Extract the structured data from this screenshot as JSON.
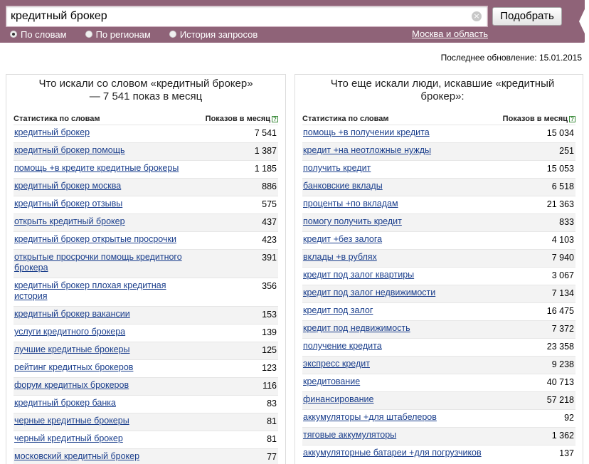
{
  "search": {
    "value": "кредитный брокер",
    "clear_glyph": "×",
    "button_label": "Подобрать",
    "modes": [
      {
        "label": "По словам",
        "checked": true
      },
      {
        "label": "По регионам",
        "checked": false
      },
      {
        "label": "История запросов",
        "checked": false
      }
    ],
    "region_label": "Москва и область"
  },
  "last_update": "Последнее обновление: 15.01.2015",
  "left_panel": {
    "title": "Что искали со словом «кредитный брокер» — 7 541 показ в месяц",
    "col_query": "Статистика по словам",
    "col_count": "Показов в месяц",
    "help_glyph": "?",
    "rows": [
      {
        "q": "кредитный брокер",
        "v": "7 541"
      },
      {
        "q": "кредитный брокер помощь",
        "v": "1 387"
      },
      {
        "q": "помощь +в кредите кредитные брокеры",
        "v": "1 185"
      },
      {
        "q": "кредитный брокер москва",
        "v": "886"
      },
      {
        "q": "кредитный брокер отзывы",
        "v": "575"
      },
      {
        "q": "открыть кредитный брокер",
        "v": "437"
      },
      {
        "q": "кредитный брокер открытые просрочки",
        "v": "423"
      },
      {
        "q": "открытые просрочки помощь кредитного брокера",
        "v": "391"
      },
      {
        "q": "кредитный брокер плохая кредитная история",
        "v": "356"
      },
      {
        "q": "кредитный брокер вакансии",
        "v": "153"
      },
      {
        "q": "услуги кредитного брокера",
        "v": "139"
      },
      {
        "q": "лучшие кредитные брокеры",
        "v": "125"
      },
      {
        "q": "рейтинг кредитных брокеров",
        "v": "123"
      },
      {
        "q": "форум кредитных брокеров",
        "v": "116"
      },
      {
        "q": "кредитный брокер банка",
        "v": "83"
      },
      {
        "q": "черные кредитные брокеры",
        "v": "81"
      },
      {
        "q": "черный кредитный брокер",
        "v": "81"
      },
      {
        "q": "московский кредитный брокер",
        "v": "77"
      }
    ]
  },
  "right_panel": {
    "title": "Что еще искали люди, искавшие «кредитный брокер»:",
    "col_query": "Статистика по словам",
    "col_count": "Показов в месяц",
    "help_glyph": "?",
    "rows": [
      {
        "q": "помощь +в получении кредита",
        "v": "15 034"
      },
      {
        "q": "кредит +на неотложные нужды",
        "v": "251"
      },
      {
        "q": "получить кредит",
        "v": "15 053"
      },
      {
        "q": "банковские вклады",
        "v": "6 518"
      },
      {
        "q": "проценты +по вкладам",
        "v": "21 363"
      },
      {
        "q": "помогу получить кредит",
        "v": "833"
      },
      {
        "q": "кредит +без залога",
        "v": "4 103"
      },
      {
        "q": "вклады +в рублях",
        "v": "7 940"
      },
      {
        "q": "кредит под залог квартиры",
        "v": "3 067"
      },
      {
        "q": "кредит под залог недвижимости",
        "v": "7 134"
      },
      {
        "q": "кредит под залог",
        "v": "16 475"
      },
      {
        "q": "кредит под недвижимость",
        "v": "7 372"
      },
      {
        "q": "получение кредита",
        "v": "23 358"
      },
      {
        "q": "экспресс кредит",
        "v": "9 238"
      },
      {
        "q": "кредитование",
        "v": "40 713"
      },
      {
        "q": "финансирование",
        "v": "57 218"
      },
      {
        "q": "аккумуляторы +для штабелеров",
        "v": "92"
      },
      {
        "q": "тяговые аккумуляторы",
        "v": "1 362"
      },
      {
        "q": "аккумуляторные батареи +для погрузчиков",
        "v": "137"
      }
    ]
  }
}
